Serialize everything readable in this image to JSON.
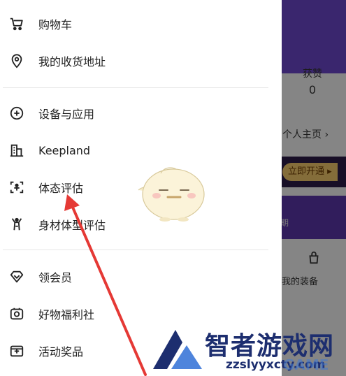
{
  "background": {
    "liked_label": "获赞",
    "liked_count": "0",
    "profile_link": "个人主页 ›",
    "vip_button": "立即开通 ▸",
    "band_text": "期",
    "equipment_label": "我的装备"
  },
  "drawer": {
    "group1": [
      {
        "label": "购物车",
        "icon": "shopping-cart-icon"
      }
    ],
    "group1b": [
      {
        "label": "我的收货地址",
        "icon": "location-pin-icon"
      }
    ],
    "group2": [
      {
        "label": "设备与应用",
        "icon": "plus-circle-icon"
      },
      {
        "label": "Keepland",
        "icon": "building-icon"
      },
      {
        "label": "体态评估",
        "icon": "body-scan-icon"
      },
      {
        "label": "身材体型评估",
        "icon": "body-shape-icon"
      }
    ],
    "group3": [
      {
        "label": "领会员",
        "icon": "diamond-icon"
      },
      {
        "label": "好物福利社",
        "icon": "gift-box-icon"
      },
      {
        "label": "活动奖品",
        "icon": "ticket-icon"
      }
    ]
  },
  "watermark": {
    "title": "智者游戏网",
    "url": "zzslyyxcty.com",
    "game": "GAME"
  },
  "colors": {
    "header_purple": "#6a45c9",
    "arrow_red": "#e53935",
    "watermark_navy": "#1d2e6f"
  }
}
